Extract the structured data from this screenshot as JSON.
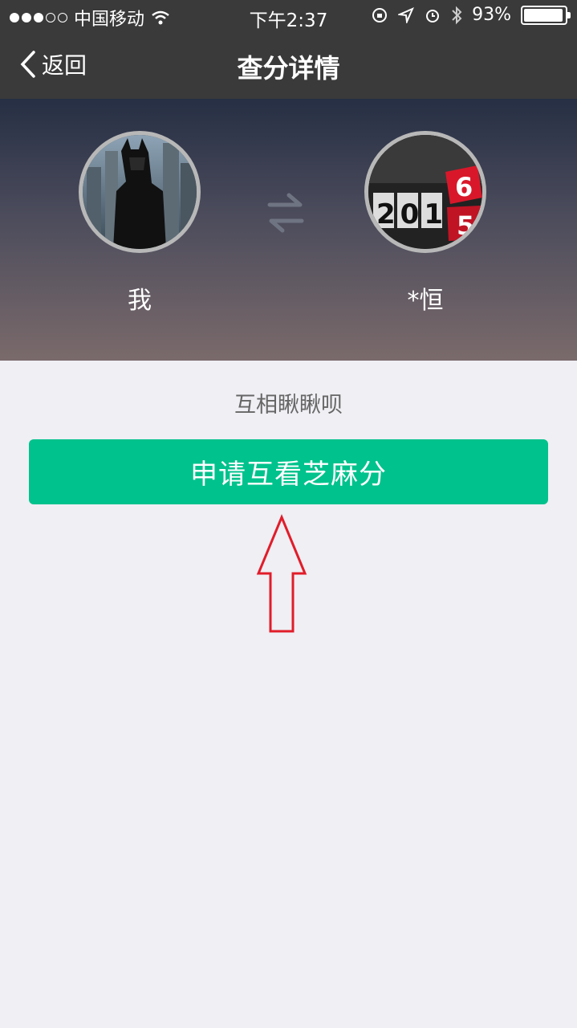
{
  "status_bar": {
    "carrier": "中国移动",
    "time": "下午2:37",
    "battery_percent": "93%",
    "battery_level": 0.93,
    "signal_dots_filled": 3,
    "signal_dots_total": 5
  },
  "nav": {
    "back_label": "返回",
    "title": "查分详情"
  },
  "profiles": {
    "me_name": "我",
    "other_name": "*恒",
    "other_avatar_text_digits": "201",
    "other_avatar_cube_top": "6",
    "other_avatar_cube_bottom": "5"
  },
  "hint_text": "互相瞅瞅呗",
  "action_button_label": "申请互看芝麻分",
  "colors": {
    "nav_bg": "#3a3a3a",
    "accent_green": "#00c28c",
    "page_bg": "#efeff4",
    "annotation_arrow": "#e11d2a"
  }
}
